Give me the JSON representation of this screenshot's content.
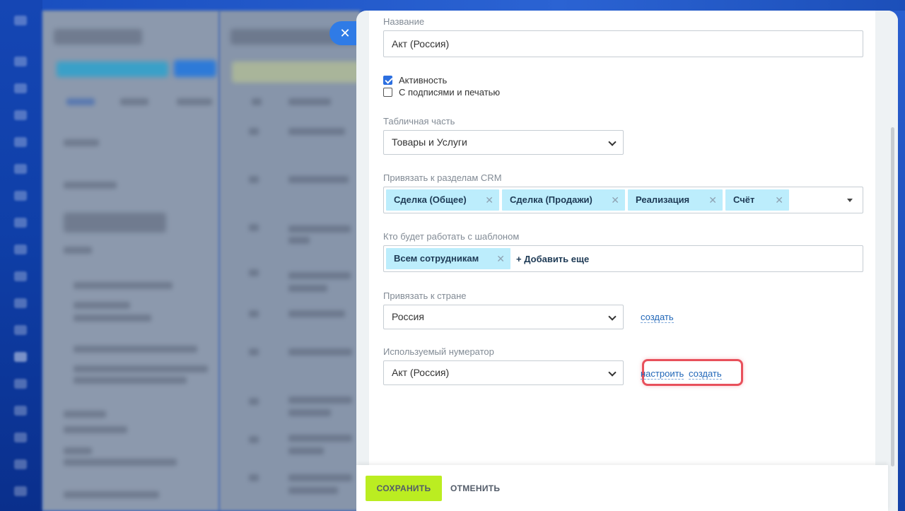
{
  "close_icon": "close-icon",
  "form": {
    "name": {
      "label": "Название",
      "value": "Акт (Россия)"
    },
    "checkboxes": [
      {
        "label": "Активность",
        "checked": true
      },
      {
        "label": "С подписями и печатью",
        "checked": false
      }
    ],
    "table_part": {
      "label": "Табличная часть",
      "value": "Товары и Услуги"
    },
    "crm_sections": {
      "label": "Привязать к разделам CRM",
      "tags": [
        "Сделка (Общее)",
        "Сделка (Продажи)",
        "Реализация",
        "Счёт"
      ]
    },
    "users": {
      "label": "Кто будет работать с шаблоном",
      "tags": [
        "Всем сотрудникам"
      ],
      "add_label": "+ Добавить еще"
    },
    "country": {
      "label": "Привязать к стране",
      "value": "Россия",
      "create_link": "создать"
    },
    "numerator": {
      "label": "Используемый нумератор",
      "value": "Акт (Россия)",
      "configure_link": "настроить",
      "create_link": "создать"
    }
  },
  "footer": {
    "save_label": "СОХРАНИТЬ",
    "cancel_label": "ОТМЕНИТЬ"
  },
  "colors": {
    "accent_button": "#bbed21",
    "tag_bg": "#bcedfc",
    "link": "#2167b8",
    "highlight_border": "#e8505b",
    "checkbox_on": "#2c6fe0"
  }
}
